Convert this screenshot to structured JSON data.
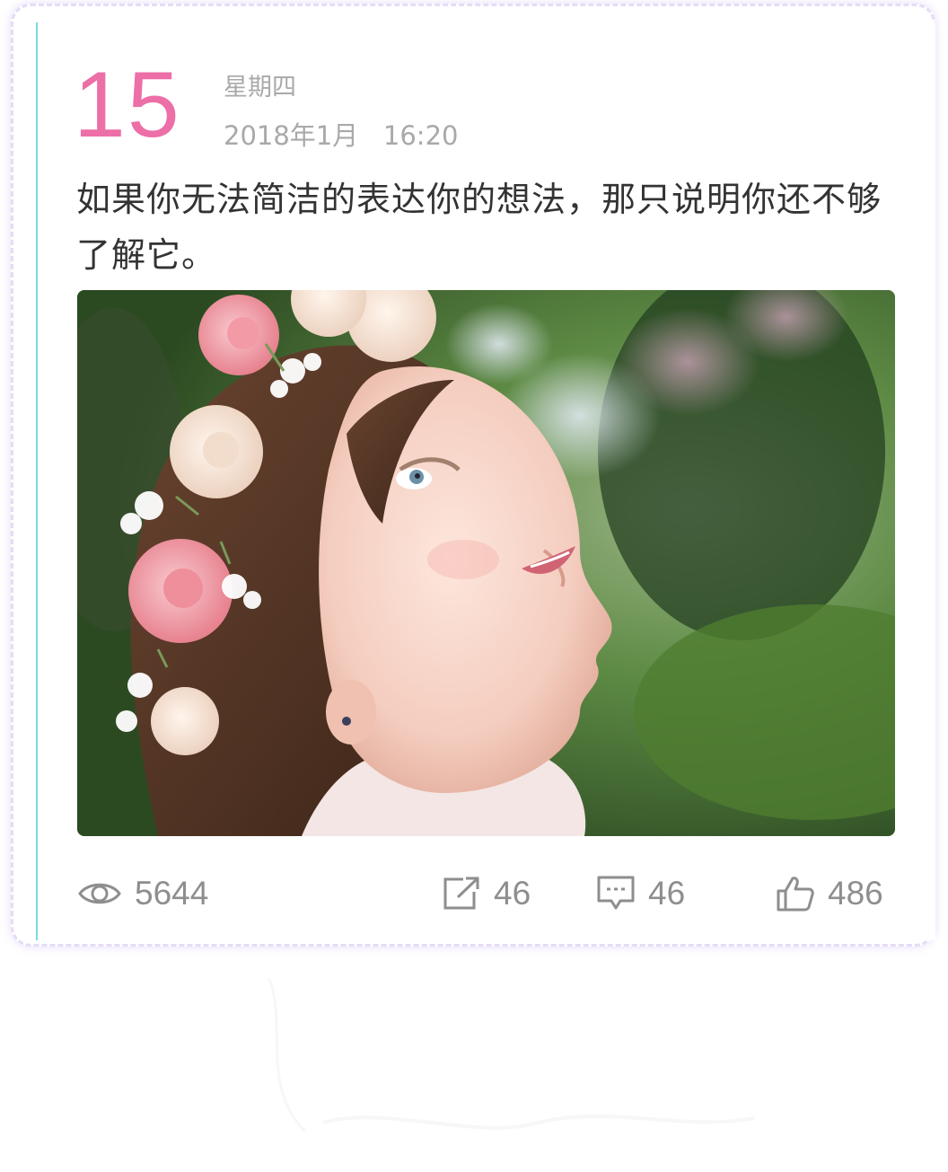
{
  "post": {
    "day": "15",
    "weekday": "星期四",
    "datetime": "2018年1月   16:20",
    "quote": "如果你无法简洁的表达你的想法，那只说明你还不够了解它。"
  },
  "photo": {
    "description_icon": "photo-girl-with-flower-crown"
  },
  "stats": {
    "views": "5644",
    "shares": "46",
    "comments": "46",
    "likes": "486"
  },
  "colors": {
    "day": "#ec6fa7",
    "muted_text": "#a9a9a9",
    "body_text": "#333333",
    "stat_text": "#8e8e8e",
    "card_border": "#e6dcf6",
    "accent_line": "#74dbe6"
  },
  "icons": {
    "views": "eye-icon",
    "shares": "share-icon",
    "comments": "comment-icon",
    "likes": "thumbs-up-icon"
  }
}
